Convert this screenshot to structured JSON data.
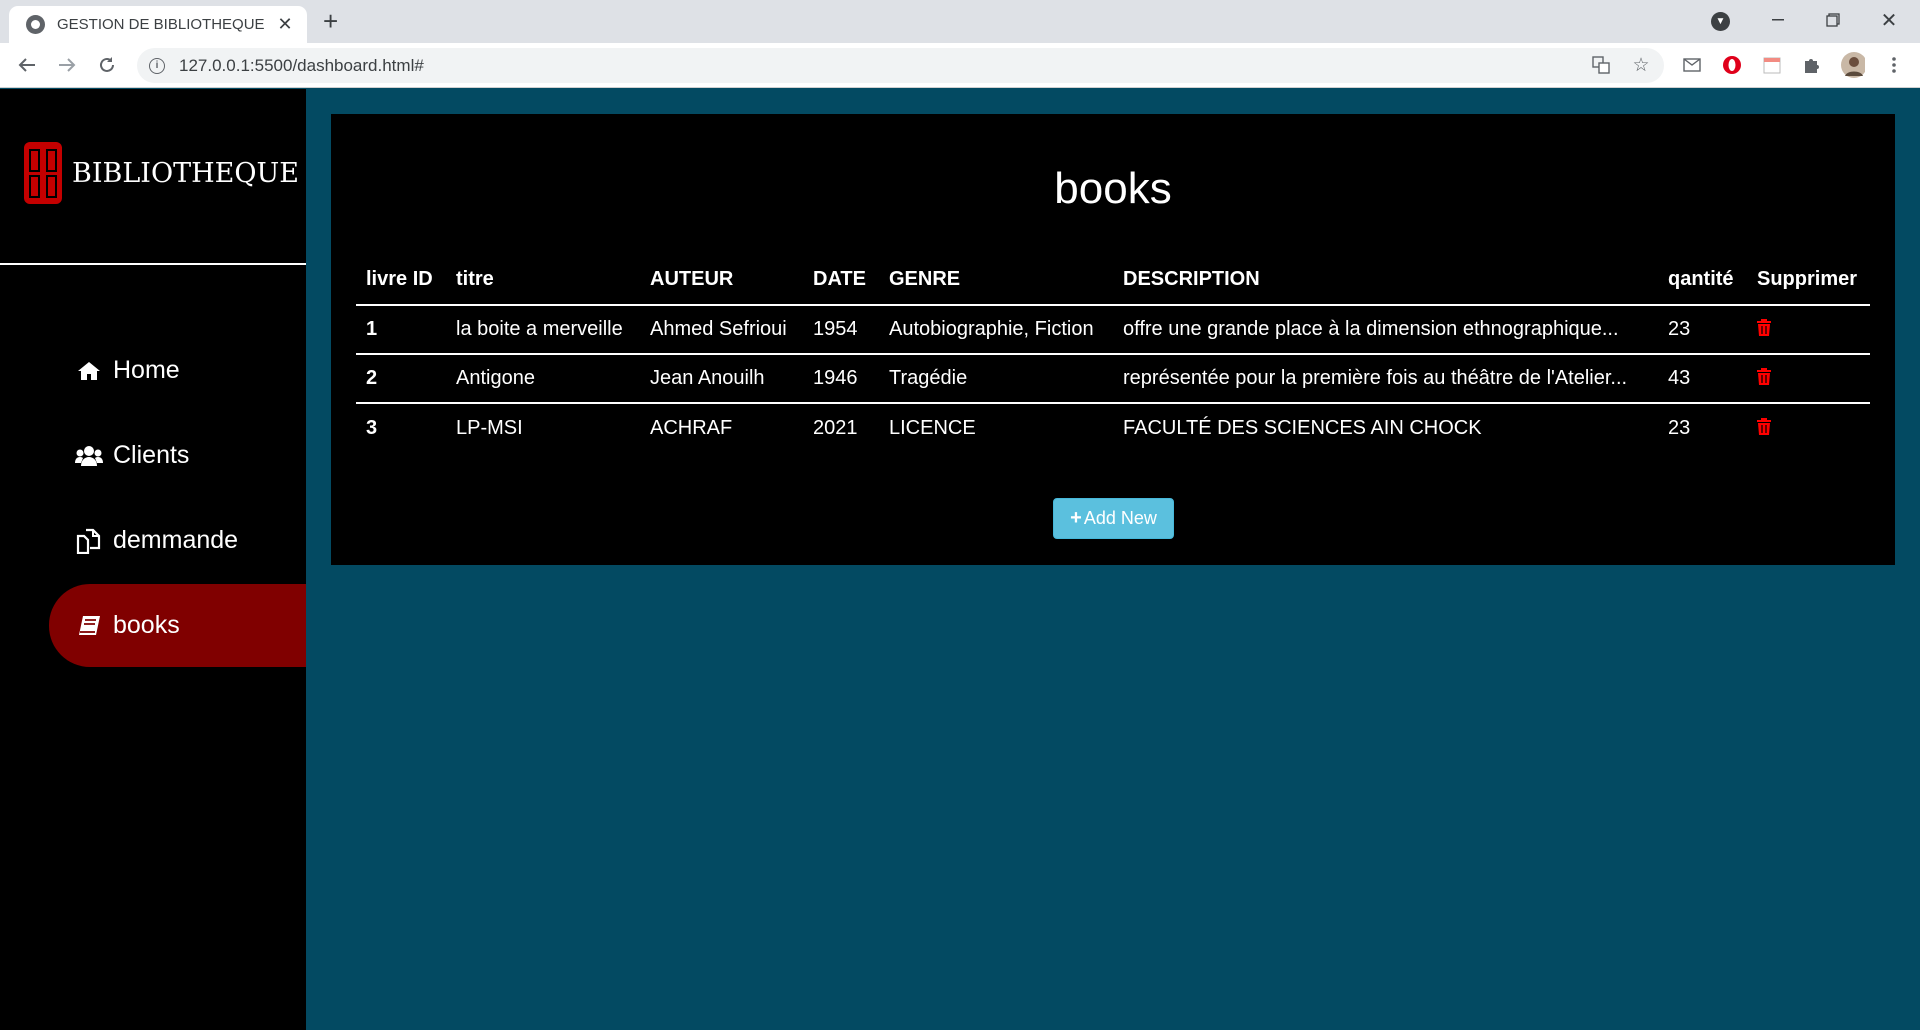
{
  "browser": {
    "tab_title": "GESTION DE BIBLIOTHEQUE",
    "url": "127.0.0.1:5500/dashboard.html#"
  },
  "sidebar": {
    "brand": "BIBLIOTHEQUE",
    "items": [
      {
        "label": "Home",
        "icon": "home-icon",
        "active": false
      },
      {
        "label": "Clients",
        "icon": "users-icon",
        "active": false
      },
      {
        "label": "demmande",
        "icon": "copy-icon",
        "active": false
      },
      {
        "label": "books",
        "icon": "book-icon",
        "active": true
      }
    ]
  },
  "main": {
    "title": "books",
    "columns": [
      "livre ID",
      "titre",
      "AUTEUR",
      "DATE",
      "GENRE",
      "DESCRIPTION",
      "qantité",
      "Supprimer"
    ],
    "rows": [
      {
        "id": "1",
        "titre": "la boite a merveille",
        "auteur": "Ahmed Sefrioui",
        "date": "1954",
        "genre": "Autobiographie, Fiction",
        "description": "offre une grande place à la dimension ethnographique...",
        "qte": "23"
      },
      {
        "id": "2",
        "titre": "Antigone",
        "auteur": "Jean Anouilh",
        "date": "1946",
        "genre": "Tragédie",
        "description": "représentée pour la première fois au théâtre de l'Atelier...",
        "qte": "43"
      },
      {
        "id": "3",
        "titre": "LP-MSI",
        "auteur": "ACHRAF",
        "date": "2021",
        "genre": "LICENCE",
        "description": "FACULTÉ DES SCIENCES AIN CHOCK",
        "qte": "23"
      }
    ],
    "add_button": "Add New"
  },
  "colors": {
    "page_bg": "#034a62",
    "sidebar_bg": "#000000",
    "active_item": "#800000",
    "add_button": "#5bc0de",
    "trash": "#ff0000"
  }
}
